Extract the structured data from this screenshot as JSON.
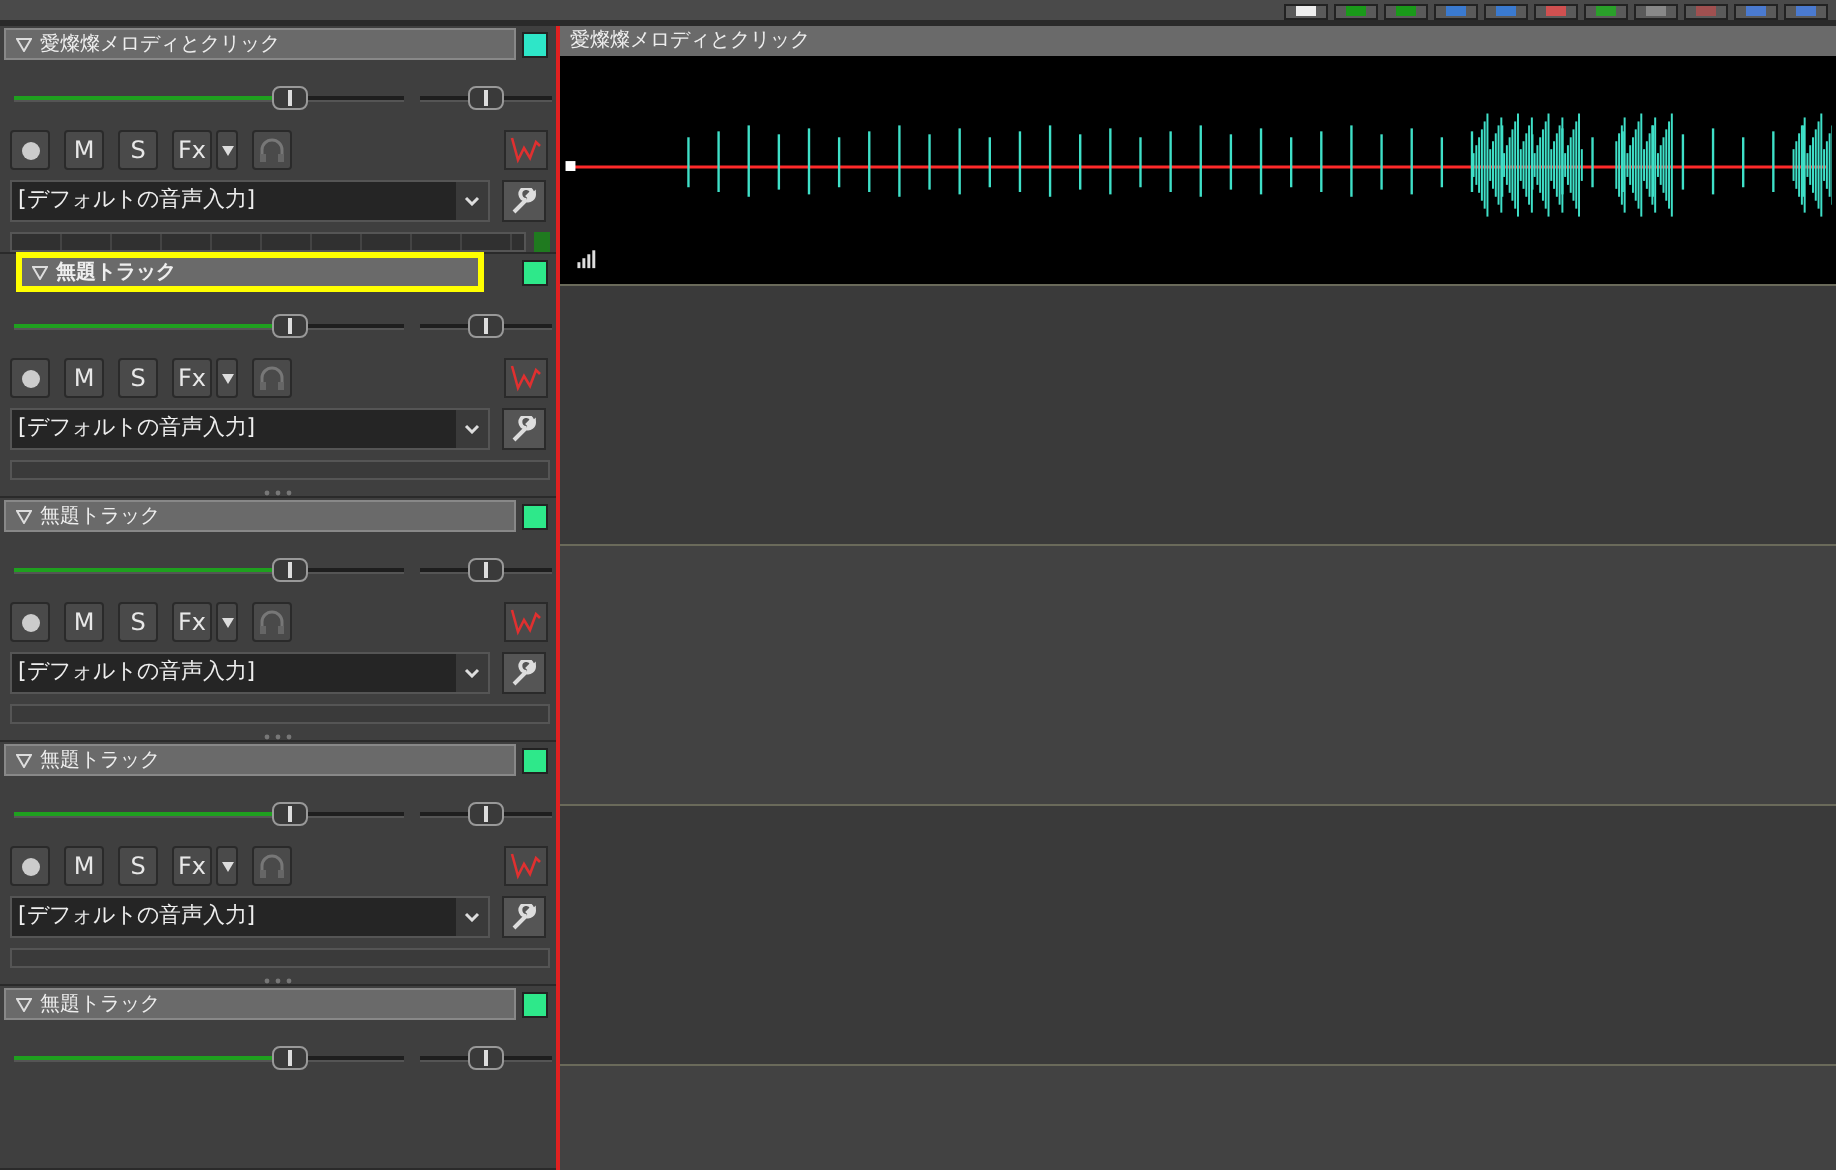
{
  "tracks": [
    {
      "name": "愛燦燦メロディとクリック",
      "selected": false,
      "color": "#2ee6c8",
      "input": "[デフォルトの音声入力]",
      "volume": {
        "level": 0.71
      },
      "pan": {
        "level": 0.5
      },
      "meter_active": true,
      "buttons": {
        "mute": "M",
        "solo": "S",
        "fx": "Fx"
      },
      "clip": {
        "title": "愛燦燦メロディとクリック"
      }
    },
    {
      "name": "無題トラック",
      "selected": true,
      "color": "#2ee88a",
      "input": "[デフォルトの音声入力]",
      "volume": {
        "level": 0.71
      },
      "pan": {
        "level": 0.5
      },
      "meter_active": false,
      "buttons": {
        "mute": "M",
        "solo": "S",
        "fx": "Fx"
      }
    },
    {
      "name": "無題トラック",
      "selected": false,
      "color": "#2ee88a",
      "input": "[デフォルトの音声入力]",
      "volume": {
        "level": 0.71
      },
      "pan": {
        "level": 0.5
      },
      "meter_active": false,
      "buttons": {
        "mute": "M",
        "solo": "S",
        "fx": "Fx"
      }
    },
    {
      "name": "無題トラック",
      "selected": false,
      "color": "#2ee88a",
      "input": "[デフォルトの音声入力]",
      "volume": {
        "level": 0.71
      },
      "pan": {
        "level": 0.5
      },
      "meter_active": false,
      "buttons": {
        "mute": "M",
        "solo": "S",
        "fx": "Fx"
      }
    },
    {
      "name": "無題トラック",
      "selected": false,
      "color": "#2ee88a",
      "volume": {
        "level": 0.71
      },
      "pan": {
        "level": 0.5
      }
    }
  ]
}
